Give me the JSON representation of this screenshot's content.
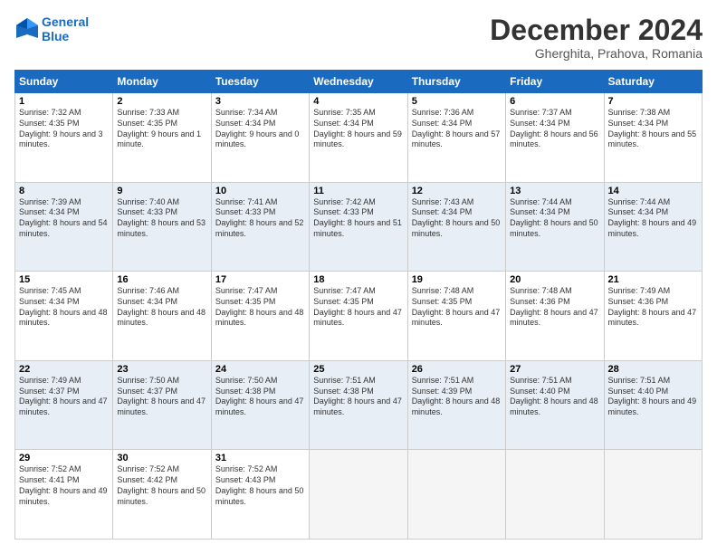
{
  "header": {
    "logo_line1": "General",
    "logo_line2": "Blue",
    "title": "December 2024",
    "location": "Gherghita, Prahova, Romania"
  },
  "days_of_week": [
    "Sunday",
    "Monday",
    "Tuesday",
    "Wednesday",
    "Thursday",
    "Friday",
    "Saturday"
  ],
  "weeks": [
    [
      {
        "day": "1",
        "rise": "Sunrise: 7:32 AM",
        "set": "Sunset: 4:35 PM",
        "daylight": "Daylight: 9 hours and 3 minutes."
      },
      {
        "day": "2",
        "rise": "Sunrise: 7:33 AM",
        "set": "Sunset: 4:35 PM",
        "daylight": "Daylight: 9 hours and 1 minute."
      },
      {
        "day": "3",
        "rise": "Sunrise: 7:34 AM",
        "set": "Sunset: 4:34 PM",
        "daylight": "Daylight: 9 hours and 0 minutes."
      },
      {
        "day": "4",
        "rise": "Sunrise: 7:35 AM",
        "set": "Sunset: 4:34 PM",
        "daylight": "Daylight: 8 hours and 59 minutes."
      },
      {
        "day": "5",
        "rise": "Sunrise: 7:36 AM",
        "set": "Sunset: 4:34 PM",
        "daylight": "Daylight: 8 hours and 57 minutes."
      },
      {
        "day": "6",
        "rise": "Sunrise: 7:37 AM",
        "set": "Sunset: 4:34 PM",
        "daylight": "Daylight: 8 hours and 56 minutes."
      },
      {
        "day": "7",
        "rise": "Sunrise: 7:38 AM",
        "set": "Sunset: 4:34 PM",
        "daylight": "Daylight: 8 hours and 55 minutes."
      }
    ],
    [
      {
        "day": "8",
        "rise": "Sunrise: 7:39 AM",
        "set": "Sunset: 4:34 PM",
        "daylight": "Daylight: 8 hours and 54 minutes."
      },
      {
        "day": "9",
        "rise": "Sunrise: 7:40 AM",
        "set": "Sunset: 4:33 PM",
        "daylight": "Daylight: 8 hours and 53 minutes."
      },
      {
        "day": "10",
        "rise": "Sunrise: 7:41 AM",
        "set": "Sunset: 4:33 PM",
        "daylight": "Daylight: 8 hours and 52 minutes."
      },
      {
        "day": "11",
        "rise": "Sunrise: 7:42 AM",
        "set": "Sunset: 4:33 PM",
        "daylight": "Daylight: 8 hours and 51 minutes."
      },
      {
        "day": "12",
        "rise": "Sunrise: 7:43 AM",
        "set": "Sunset: 4:34 PM",
        "daylight": "Daylight: 8 hours and 50 minutes."
      },
      {
        "day": "13",
        "rise": "Sunrise: 7:44 AM",
        "set": "Sunset: 4:34 PM",
        "daylight": "Daylight: 8 hours and 50 minutes."
      },
      {
        "day": "14",
        "rise": "Sunrise: 7:44 AM",
        "set": "Sunset: 4:34 PM",
        "daylight": "Daylight: 8 hours and 49 minutes."
      }
    ],
    [
      {
        "day": "15",
        "rise": "Sunrise: 7:45 AM",
        "set": "Sunset: 4:34 PM",
        "daylight": "Daylight: 8 hours and 48 minutes."
      },
      {
        "day": "16",
        "rise": "Sunrise: 7:46 AM",
        "set": "Sunset: 4:34 PM",
        "daylight": "Daylight: 8 hours and 48 minutes."
      },
      {
        "day": "17",
        "rise": "Sunrise: 7:47 AM",
        "set": "Sunset: 4:35 PM",
        "daylight": "Daylight: 8 hours and 48 minutes."
      },
      {
        "day": "18",
        "rise": "Sunrise: 7:47 AM",
        "set": "Sunset: 4:35 PM",
        "daylight": "Daylight: 8 hours and 47 minutes."
      },
      {
        "day": "19",
        "rise": "Sunrise: 7:48 AM",
        "set": "Sunset: 4:35 PM",
        "daylight": "Daylight: 8 hours and 47 minutes."
      },
      {
        "day": "20",
        "rise": "Sunrise: 7:48 AM",
        "set": "Sunset: 4:36 PM",
        "daylight": "Daylight: 8 hours and 47 minutes."
      },
      {
        "day": "21",
        "rise": "Sunrise: 7:49 AM",
        "set": "Sunset: 4:36 PM",
        "daylight": "Daylight: 8 hours and 47 minutes."
      }
    ],
    [
      {
        "day": "22",
        "rise": "Sunrise: 7:49 AM",
        "set": "Sunset: 4:37 PM",
        "daylight": "Daylight: 8 hours and 47 minutes."
      },
      {
        "day": "23",
        "rise": "Sunrise: 7:50 AM",
        "set": "Sunset: 4:37 PM",
        "daylight": "Daylight: 8 hours and 47 minutes."
      },
      {
        "day": "24",
        "rise": "Sunrise: 7:50 AM",
        "set": "Sunset: 4:38 PM",
        "daylight": "Daylight: 8 hours and 47 minutes."
      },
      {
        "day": "25",
        "rise": "Sunrise: 7:51 AM",
        "set": "Sunset: 4:38 PM",
        "daylight": "Daylight: 8 hours and 47 minutes."
      },
      {
        "day": "26",
        "rise": "Sunrise: 7:51 AM",
        "set": "Sunset: 4:39 PM",
        "daylight": "Daylight: 8 hours and 48 minutes."
      },
      {
        "day": "27",
        "rise": "Sunrise: 7:51 AM",
        "set": "Sunset: 4:40 PM",
        "daylight": "Daylight: 8 hours and 48 minutes."
      },
      {
        "day": "28",
        "rise": "Sunrise: 7:51 AM",
        "set": "Sunset: 4:40 PM",
        "daylight": "Daylight: 8 hours and 49 minutes."
      }
    ],
    [
      {
        "day": "29",
        "rise": "Sunrise: 7:52 AM",
        "set": "Sunset: 4:41 PM",
        "daylight": "Daylight: 8 hours and 49 minutes."
      },
      {
        "day": "30",
        "rise": "Sunrise: 7:52 AM",
        "set": "Sunset: 4:42 PM",
        "daylight": "Daylight: 8 hours and 50 minutes."
      },
      {
        "day": "31",
        "rise": "Sunrise: 7:52 AM",
        "set": "Sunset: 4:43 PM",
        "daylight": "Daylight: 8 hours and 50 minutes."
      },
      null,
      null,
      null,
      null
    ]
  ]
}
